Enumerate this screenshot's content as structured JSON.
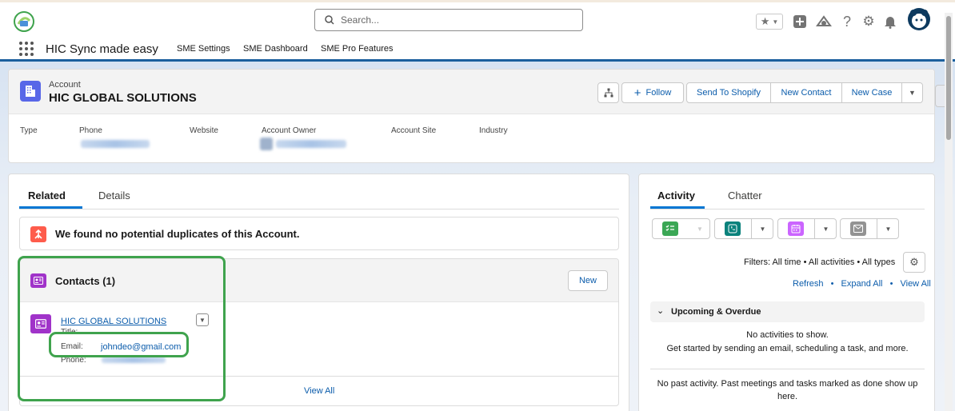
{
  "global_header": {
    "search_placeholder": "Search...",
    "utility_icons": [
      "favorites-star-icon",
      "favorites-dropdown-icon",
      "global-add-icon",
      "trailhead-icon",
      "help-icon",
      "setup-gear-icon",
      "notifications-bell-icon",
      "user-avatar-icon"
    ]
  },
  "nav": {
    "app_name": "HIC Sync made easy",
    "items": [
      "SME Settings",
      "SME Dashboard",
      "SME Pro Features"
    ]
  },
  "record": {
    "object_label": "Account",
    "name": "HIC GLOBAL SOLUTIONS",
    "actions": {
      "follow": "Follow",
      "send_to_shopify": "Send To Shopify",
      "new_contact": "New Contact",
      "new_case": "New Case"
    },
    "fields": [
      {
        "label": "Type"
      },
      {
        "label": "Phone"
      },
      {
        "label": "Website"
      },
      {
        "label": "Account Owner"
      },
      {
        "label": "Account Site"
      },
      {
        "label": "Industry"
      }
    ]
  },
  "left_panel": {
    "tabs": [
      "Related",
      "Details"
    ],
    "duplicates_message": "We found no potential duplicates of this Account.",
    "contacts": {
      "title": "Contacts (1)",
      "new_label": "New",
      "contact_name": "HIC GLOBAL SOLUTIONS",
      "title_label": "Title:",
      "email_label": "Email:",
      "email_value": "johndeo@gmail.com",
      "phone_label": "Phone:",
      "view_all": "View All"
    }
  },
  "right_panel": {
    "tabs": [
      "Activity",
      "Chatter"
    ],
    "filters_text": "Filters: All time • All activities • All types",
    "links": {
      "refresh": "Refresh",
      "expand_all": "Expand All",
      "view_all": "View All"
    },
    "separator": "•",
    "upcoming_title": "Upcoming & Overdue",
    "no_activities": "No activities to show.",
    "get_started": "Get started by sending an email, scheduling a task, and more.",
    "no_past_activity": "No past activity. Past meetings and tasks marked as done show up here."
  },
  "colors": {
    "brand_blue": "#0176d3",
    "link_blue": "#0b5cab",
    "account_icon": "#5867e8",
    "contact_icon": "#a033c9",
    "duplicate_icon": "#fe5c4c",
    "highlight_green": "#3fa34d",
    "task_green": "#3ba755",
    "call_teal": "#0b827c",
    "event_purple": "#cb65ff",
    "email_gray": "#939393"
  }
}
